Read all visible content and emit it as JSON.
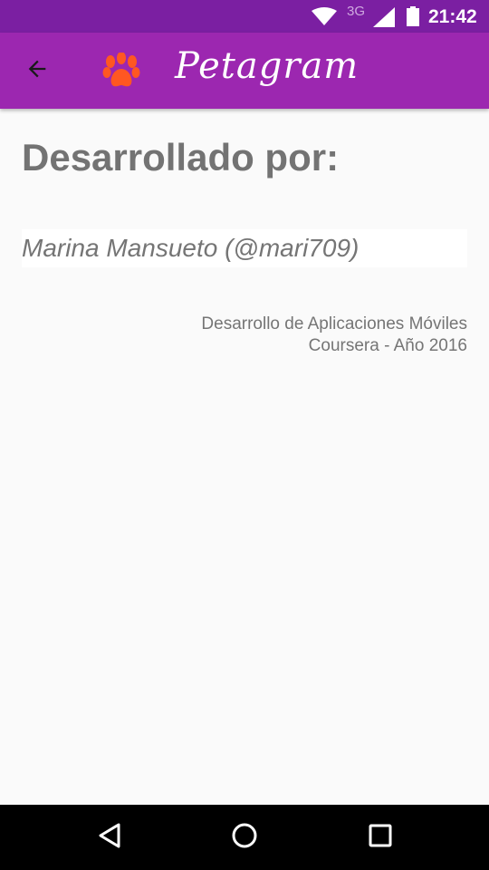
{
  "status_bar": {
    "network_type": "3G",
    "time": "21:42",
    "icons": [
      "wifi-icon",
      "signal-icon",
      "battery-icon"
    ]
  },
  "app_bar": {
    "title": "Petagram",
    "back_icon": "arrow-back-icon",
    "logo_icon": "paw-icon",
    "background_color": "#9c27b0",
    "logo_color": "#ff5722"
  },
  "content": {
    "heading": "Desarrollado por:",
    "developer": "Marina Mansueto (@mari709)",
    "credits_line1": "Desarrollo de Aplicaciones Móviles",
    "credits_line2": "Coursera - Año 2016"
  },
  "nav_bar": {
    "icons": [
      "nav-back-icon",
      "nav-home-icon",
      "nav-recents-icon"
    ]
  }
}
